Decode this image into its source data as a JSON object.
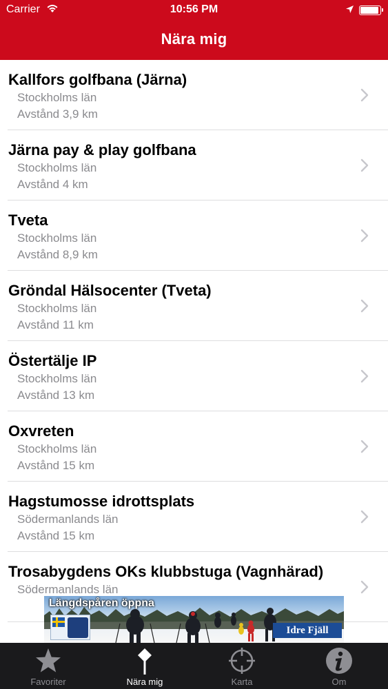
{
  "status_bar": {
    "carrier": "Carrier",
    "time": "10:56 PM",
    "battery_level": 0.95
  },
  "nav": {
    "title": "Nära mig"
  },
  "colors": {
    "header_red": "#cc0a1c",
    "tab_bar": "#1a1a1c",
    "tab_active": "#ffffff",
    "tab_inactive": "#8e8e93",
    "subtitle_gray": "#8a8a8e"
  },
  "places": [
    {
      "name": "Kallfors golfbana (Järna)",
      "region": "Stockholms län",
      "distance": "Avstånd 3,9 km"
    },
    {
      "name": "Järna pay & play golfbana",
      "region": "Stockholms län",
      "distance": "Avstånd 4 km"
    },
    {
      "name": "Tveta",
      "region": "Stockholms län",
      "distance": "Avstånd 8,9 km"
    },
    {
      "name": "Gröndal Hälsocenter (Tveta)",
      "region": "Stockholms län",
      "distance": "Avstånd 11 km"
    },
    {
      "name": "Östertälje IP",
      "region": "Stockholms län",
      "distance": "Avstånd 13 km"
    },
    {
      "name": "Oxvreten",
      "region": "Stockholms län",
      "distance": "Avstånd 15 km"
    },
    {
      "name": "Hagstumosse idrottsplats",
      "region": "Södermanlands län",
      "distance": "Avstånd 15 km"
    },
    {
      "name": "Trosabygdens OKs klubbstuga (Vagnhärad)",
      "region": "Södermanlands län",
      "distance": ""
    }
  ],
  "ad": {
    "headline": "Längdspåren öppna",
    "brand": "Idre Fjäll"
  },
  "tabs": [
    {
      "label": "Favoriter",
      "icon": "star-icon",
      "active": false
    },
    {
      "label": "Nära mig",
      "icon": "location-pin-icon",
      "active": true
    },
    {
      "label": "Karta",
      "icon": "crosshair-icon",
      "active": false
    },
    {
      "label": "Om",
      "icon": "info-icon",
      "active": false
    }
  ]
}
